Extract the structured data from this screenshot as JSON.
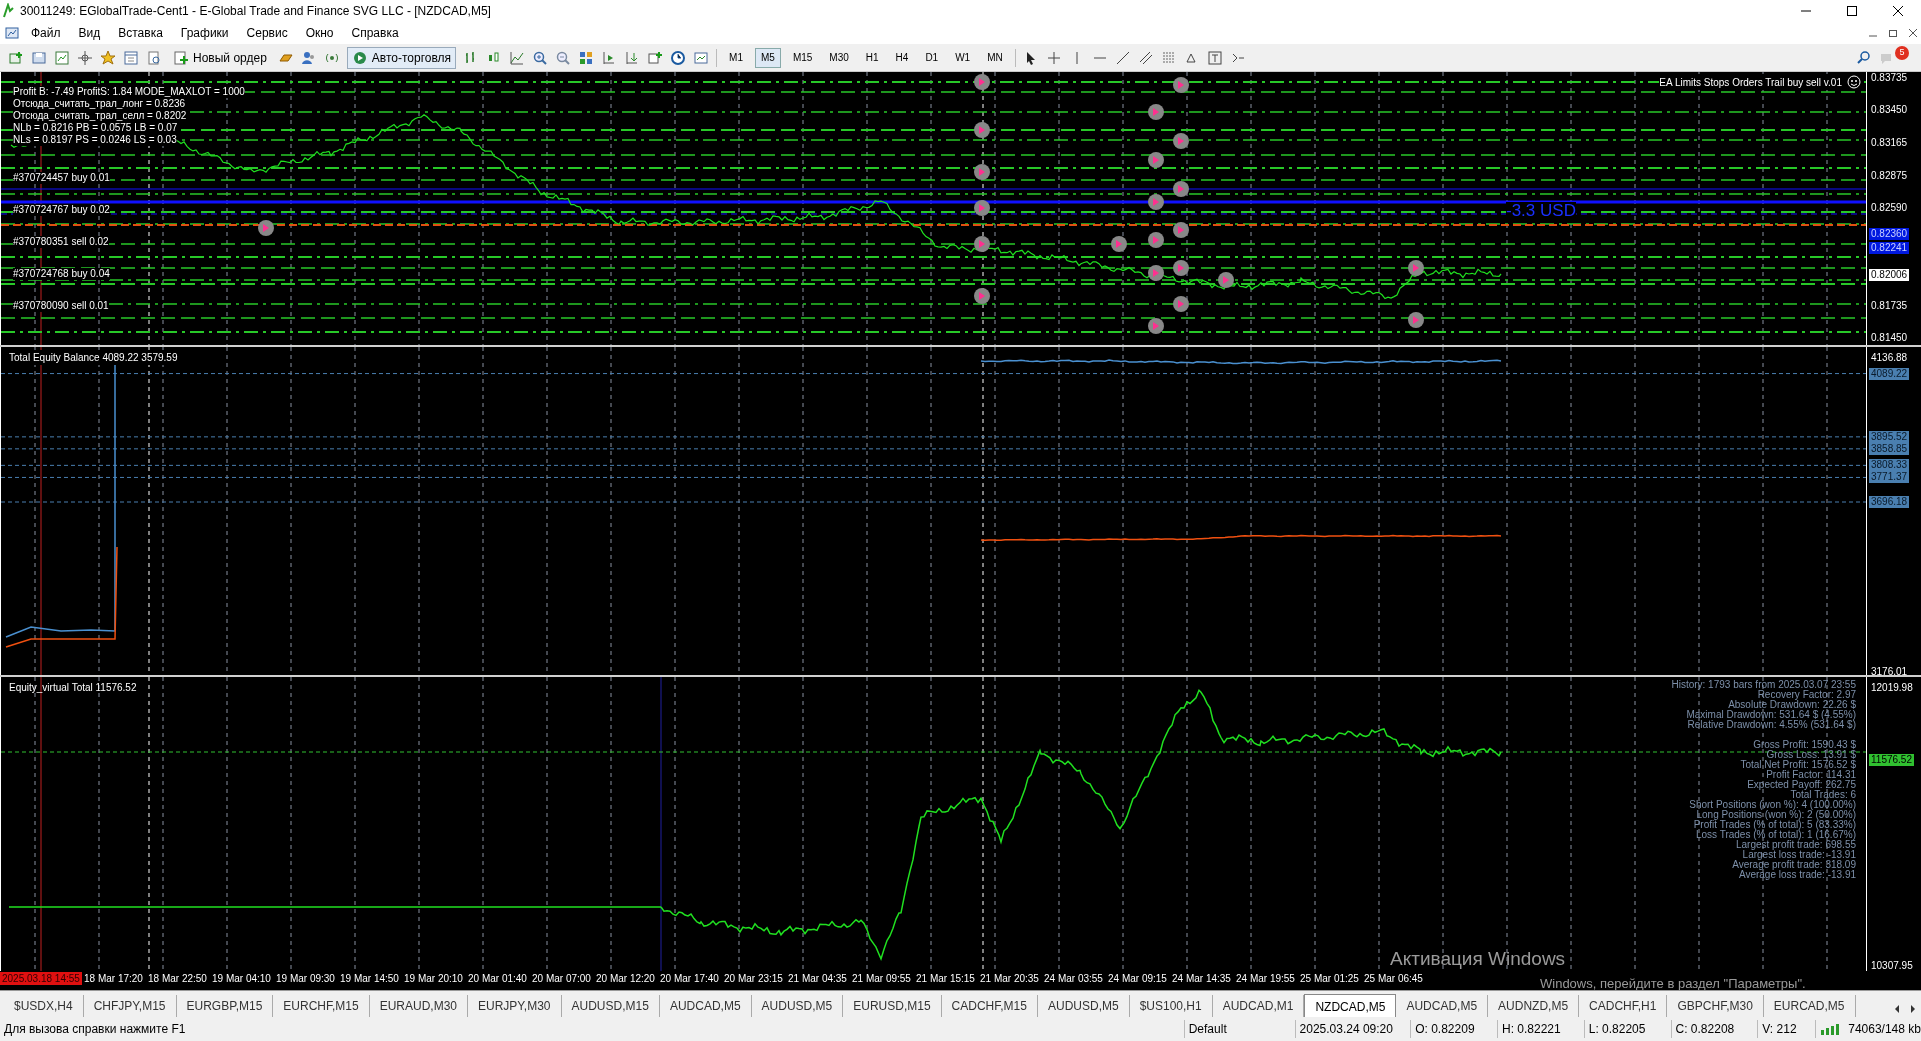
{
  "window": {
    "title": "30011249: EGlobalTrade-Cent1 - E-Global Trade and Finance SVG LLC - [NZDCAD,M5]"
  },
  "menu": [
    "Файл",
    "Вид",
    "Вставка",
    "Графики",
    "Сервис",
    "Окно",
    "Справка"
  ],
  "toolbar": {
    "new_order": "Новый ордер",
    "autotrading": "Авто-торговля",
    "alerts_badge": "5",
    "timeframes": [
      {
        "label": "M1",
        "selected": false
      },
      {
        "label": "M5",
        "selected": true
      },
      {
        "label": "M15",
        "selected": false
      },
      {
        "label": "M30",
        "selected": false
      },
      {
        "label": "H1",
        "selected": false
      },
      {
        "label": "H4",
        "selected": false
      },
      {
        "label": "D1",
        "selected": false
      },
      {
        "label": "W1",
        "selected": false
      },
      {
        "label": "MN",
        "selected": false
      }
    ]
  },
  "main_chart": {
    "info_lines": [
      "Profit B: -7.49 ProfitS: 1.84 MODE_MAXLOT = 1000",
      "Отсюда_считать_трал_лонг = 0.8236",
      "Отсюда_считать_трал_селл = 0.8202",
      "NLb = 0.8216 PB = 0.0575 LB = 0.07",
      "NLs = 0.8197 PS = 0.0246 LS = 0.03"
    ],
    "order_labels": [
      "#370724457 buy 0.01",
      "#370724767 buy 0.02",
      "#370780351 sell 0.02",
      "#370724768 buy 0.04",
      "#370780090 sell 0.01"
    ],
    "expert_title": "EA Limits Stops Orders Trail buy sell v.01",
    "profit_label": "-3.3 USD",
    "price_scale": [
      {
        "label": "0.83735",
        "kind": "tick"
      },
      {
        "label": "0.83450",
        "kind": "tick"
      },
      {
        "label": "0.83165",
        "kind": "tick"
      },
      {
        "label": "0.82875",
        "kind": "tick"
      },
      {
        "label": "0.82590",
        "kind": "tick"
      },
      {
        "label": "0.82360",
        "kind": "line_tag"
      },
      {
        "label": "0.82241",
        "kind": "line_tag"
      },
      {
        "label": "0.82006",
        "kind": "bid_tag"
      },
      {
        "label": "0.81735",
        "kind": "tick"
      },
      {
        "label": "0.81450",
        "kind": "tick"
      }
    ]
  },
  "equity_pane": {
    "title": "Total Equity Balance 4089.22 3579.59",
    "scale": [
      {
        "label": "4136.88",
        "kind": "tick"
      },
      {
        "label": "4089.22",
        "kind": "tag"
      },
      {
        "label": "3895.52",
        "kind": "tag"
      },
      {
        "label": "3858.85",
        "kind": "tag"
      },
      {
        "label": "3808.33",
        "kind": "tag"
      },
      {
        "label": "3771.37",
        "kind": "tag"
      },
      {
        "label": "3696.18",
        "kind": "tag"
      },
      {
        "label": "3176.01",
        "kind": "tick"
      }
    ]
  },
  "virtual_pane": {
    "title": "Equity_virtual Total 11576.52",
    "stats_groups": [
      [
        "History: 1793 bars from 2025.03.07 23:55",
        "Recovery Factor: 2.97",
        "Absolute Drawdown: 22.26 $",
        "Maximal Drawdown: 531.64 $ (4.55%)",
        "Relative Drawdown: 4.55% (531.64 $)"
      ],
      [
        "Gross Profit: 1590.43 $",
        "Gross Loss: 13.91 $",
        "Total Net Profit: 1576.52 $",
        "Profit Factor: 114.31",
        "Expected Payoff: 262.75",
        "Total Trades: 6",
        "Short Positions (won %): 4 (100.00%)",
        "Long Positions (won %): 2 (50.00%)",
        "Profit Trades (% of total): 5 (83.33%)",
        "Loss Trades (% of total): 1 (16.67%)",
        "Largest profit trade: 698.55",
        "Largest loss trade: -13.91",
        "Average profit trade: 318.09",
        "Average loss trade: -13.91"
      ]
    ],
    "scale": [
      {
        "label": "12019.98",
        "kind": "tick"
      },
      {
        "label": "11576.52",
        "kind": "tag"
      },
      {
        "label": "10307.95",
        "kind": "tick"
      }
    ]
  },
  "time_axis": [
    {
      "label": "2025.03.18 14:55",
      "kind": "cursor"
    },
    {
      "label": "18 Mar 17:20",
      "kind": "tick"
    },
    {
      "label": "18 Mar 22:50",
      "kind": "tick"
    },
    {
      "label": "19 Mar 04:10",
      "kind": "tick"
    },
    {
      "label": "19 Mar 09:30",
      "kind": "tick"
    },
    {
      "label": "19 Mar 14:50",
      "kind": "tick"
    },
    {
      "label": "19 Mar 20:10",
      "kind": "tick"
    },
    {
      "label": "20 Mar 01:40",
      "kind": "tick"
    },
    {
      "label": "20 Mar 07:00",
      "kind": "tick"
    },
    {
      "label": "20 Mar 12:20",
      "kind": "tick"
    },
    {
      "label": "20 Mar 17:40",
      "kind": "tick"
    },
    {
      "label": "20 Mar 23:15",
      "kind": "tick"
    },
    {
      "label": "21 Mar 04:35",
      "kind": "tick"
    },
    {
      "label": "21 Mar 09:55",
      "kind": "tick"
    },
    {
      "label": "21 Mar 15:15",
      "kind": "tick"
    },
    {
      "label": "21 Mar 20:35",
      "kind": "tick"
    },
    {
      "label": "24 Mar 03:55",
      "kind": "tick"
    },
    {
      "label": "24 Mar 09:15",
      "kind": "tick"
    },
    {
      "label": "24 Mar 14:35",
      "kind": "tick"
    },
    {
      "label": "24 Mar 19:55",
      "kind": "tick"
    },
    {
      "label": "25 Mar 01:25",
      "kind": "tick"
    },
    {
      "label": "25 Mar 06:45",
      "kind": "tick"
    }
  ],
  "os_notice": {
    "title": "Активация Windows",
    "text": "Windows, перейдите в раздел \"Параметры\"."
  },
  "symbol_tabs": [
    {
      "label": "$USDX,H4",
      "selected": false
    },
    {
      "label": "CHFJPY,M15",
      "selected": false
    },
    {
      "label": "EURGBP,M15",
      "selected": false
    },
    {
      "label": "EURCHF,M15",
      "selected": false
    },
    {
      "label": "EURAUD,M30",
      "selected": false
    },
    {
      "label": "EURJPY,M30",
      "selected": false
    },
    {
      "label": "AUDUSD,M15",
      "selected": false
    },
    {
      "label": "AUDCAD,M5",
      "selected": false
    },
    {
      "label": "AUDUSD,M5",
      "selected": false
    },
    {
      "label": "EURUSD,M15",
      "selected": false
    },
    {
      "label": "CADCHF,M15",
      "selected": false
    },
    {
      "label": "AUDUSD,M5",
      "selected": false
    },
    {
      "label": "$US100,H1",
      "selected": false
    },
    {
      "label": "AUDCAD,M1",
      "selected": false
    },
    {
      "label": "NZDCAD,M5",
      "selected": true
    },
    {
      "label": "AUDCAD,M5",
      "selected": false
    },
    {
      "label": "AUDNZD,M5",
      "selected": false
    },
    {
      "label": "CADCHF,H1",
      "selected": false
    },
    {
      "label": "GBPCHF,M30",
      "selected": false
    },
    {
      "label": "EURCAD,M5",
      "selected": false
    }
  ],
  "status_bar": {
    "hint": "Для вызова справки нажмите F1",
    "profile": "Default",
    "time": "2025.03.24 09:20",
    "open": "O: 0.82209",
    "high": "H: 0.82221",
    "low": "L: 0.82205",
    "close": "C: 0.82208",
    "volume": "V: 212",
    "traffic": "74063/148 kb"
  }
}
